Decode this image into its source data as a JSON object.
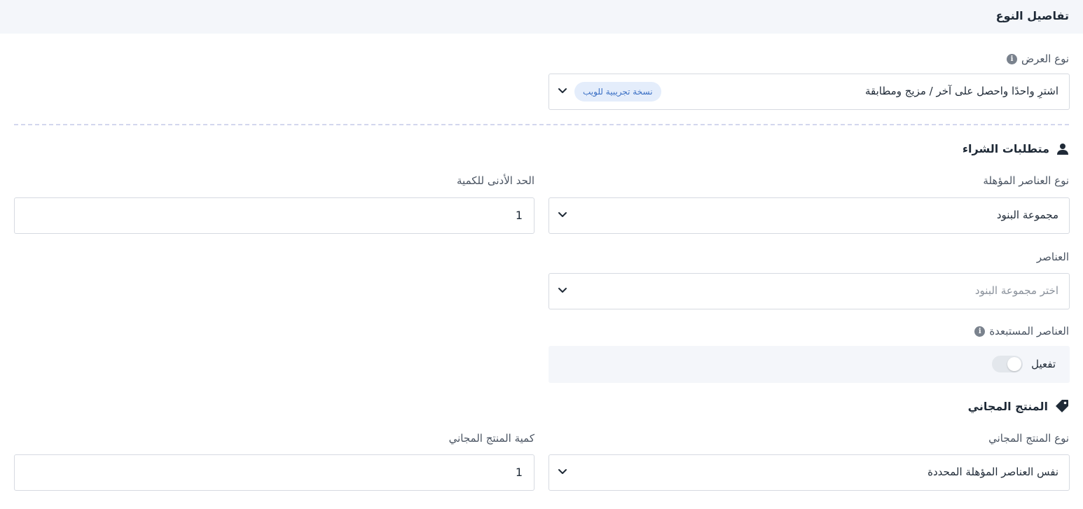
{
  "header": {
    "title": "تفاصيل النوع"
  },
  "offer_type": {
    "label": "نوع العرض",
    "info_icon": "info-icon",
    "value": "اشترِ واحدًا واحصل على آخر / مزيج ومطابقة",
    "badge": "نسخة تجريبية للويب"
  },
  "purchase_requirements": {
    "heading": "متطلبات الشراء",
    "icon": "user-icon",
    "eligible_type_label": "نوع العناصر المؤهلة",
    "eligible_type_value": "مجموعة البنود",
    "min_quantity_label": "الحد الأدنى للكمية",
    "min_quantity_value": "1",
    "items_label": "العناصر",
    "items_placeholder": "اختر مجموعة البنود",
    "excluded_label": "العناصر المستبعدة",
    "excluded_info_icon": "info-icon",
    "toggle_label": "تفعيل",
    "toggle_on": false
  },
  "free_product": {
    "heading": "المنتج المجاني",
    "icon": "tag-icon",
    "type_label": "نوع المنتج المجاني",
    "type_value": "نفس العناصر المؤهلة المحددة",
    "quantity_label": "كمية المنتج المجاني",
    "quantity_value": "1"
  },
  "colors": {
    "header_bg": "#f4f6fa",
    "badge_bg": "#e4edfb",
    "badge_text": "#3a6fc4",
    "border": "#d6dae1"
  }
}
